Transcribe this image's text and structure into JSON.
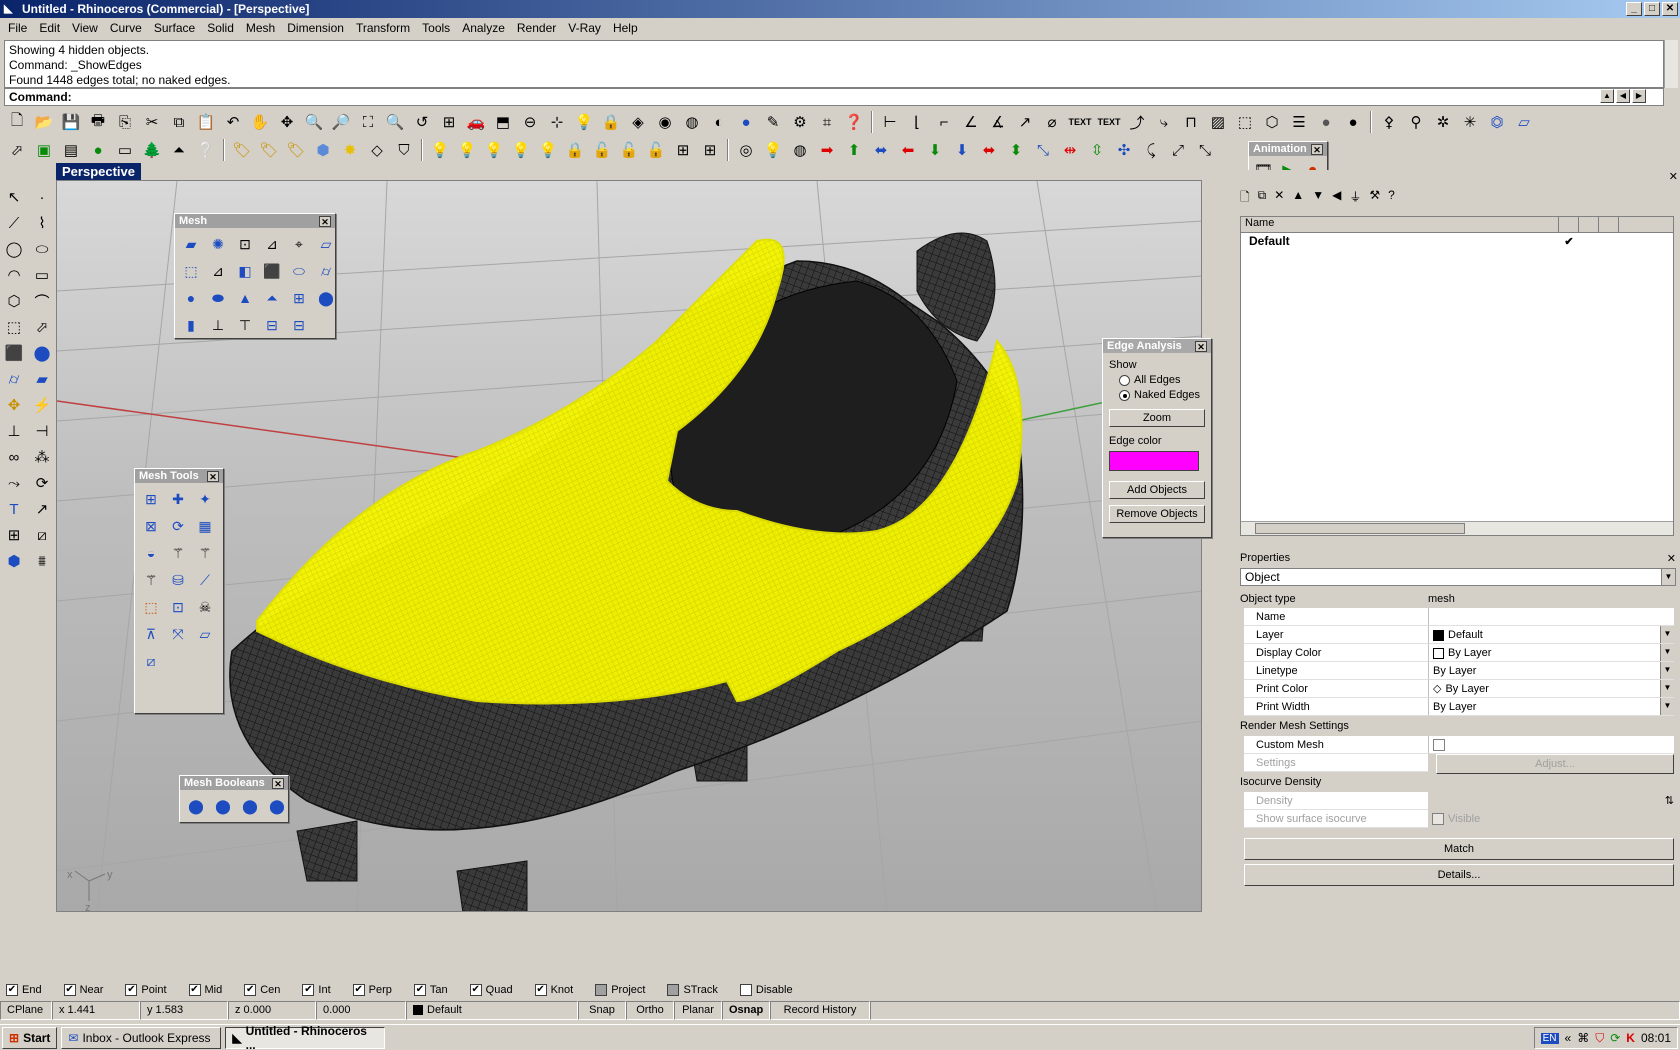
{
  "window": {
    "title": "Untitled - Rhinoceros (Commercial) - [Perspective]",
    "minimize": "_",
    "maximize": "□",
    "close": "✕"
  },
  "menu": [
    "File",
    "Edit",
    "View",
    "Curve",
    "Surface",
    "Solid",
    "Mesh",
    "Dimension",
    "Transform",
    "Tools",
    "Analyze",
    "Render",
    "V-Ray",
    "Help"
  ],
  "command": {
    "history": [
      "Showing 4 hidden objects.",
      "Command: _ShowEdges",
      "Found 1448 edges total; no naked edges."
    ],
    "prompt_label": "Command:",
    "value": ""
  },
  "toolbar_text": {
    "text1": "TEXT",
    "text2": "TEXT"
  },
  "viewport": {
    "title": "Perspective",
    "axis_x": "x",
    "axis_y": "y",
    "axis_z": "z"
  },
  "palettes": {
    "mesh": {
      "title": "Mesh"
    },
    "mesh_tools": {
      "title": "Mesh Tools"
    },
    "mesh_booleans": {
      "title": "Mesh Booleans"
    },
    "animation": {
      "title": "Animation"
    }
  },
  "edge_analysis": {
    "title": "Edge Analysis",
    "show_label": "Show",
    "all_edges": "All Edges",
    "naked_edges": "Naked Edges",
    "selected": "naked_edges",
    "zoom": "Zoom",
    "edge_color_label": "Edge color",
    "edge_color": "#ff00ff",
    "add_objects": "Add Objects",
    "remove_objects": "Remove Objects"
  },
  "layers": {
    "column_name": "Name",
    "rows": [
      {
        "name": "Default",
        "current": "✔"
      }
    ]
  },
  "properties": {
    "title": "Properties",
    "selector": "Object",
    "object_type_label": "Object type",
    "object_type_value": "mesh",
    "rows": [
      {
        "key": "Name",
        "value": ""
      },
      {
        "key": "Layer",
        "value": "Default"
      },
      {
        "key": "Display Color",
        "value": "By Layer"
      },
      {
        "key": "Linetype",
        "value": "By Layer"
      },
      {
        "key": "Print Color",
        "value": "By Layer"
      },
      {
        "key": "Print Width",
        "value": "By Layer"
      }
    ],
    "render_mesh_label": "Render Mesh Settings",
    "custom_mesh": "Custom Mesh",
    "settings": "Settings",
    "adjust": "Adjust...",
    "isocurve_label": "Isocurve Density",
    "density": "Density",
    "show_surface_isocurve": "Show surface isocurve",
    "visible": "Visible",
    "match": "Match",
    "details": "Details..."
  },
  "osnaps": [
    {
      "label": "End",
      "on": true
    },
    {
      "label": "Near",
      "on": true
    },
    {
      "label": "Point",
      "on": true
    },
    {
      "label": "Mid",
      "on": true
    },
    {
      "label": "Cen",
      "on": true
    },
    {
      "label": "Int",
      "on": true
    },
    {
      "label": "Perp",
      "on": true
    },
    {
      "label": "Tan",
      "on": true
    },
    {
      "label": "Quad",
      "on": true
    },
    {
      "label": "Knot",
      "on": true
    },
    {
      "label": "Project",
      "on": false
    },
    {
      "label": "STrack",
      "on": false
    },
    {
      "label": "Disable",
      "on": false
    }
  ],
  "status": {
    "cplane": "CPlane",
    "x": "x 1.441",
    "y": "y 1.583",
    "z": "z 0.000",
    "dist": "0.000",
    "layer": "Default",
    "snap": "Snap",
    "ortho": "Ortho",
    "planar": "Planar",
    "osnap": "Osnap",
    "record_history": "Record History"
  },
  "taskbar": {
    "start": "Start",
    "task1": "Inbox - Outlook Express",
    "task2": "Untitled - Rhinoceros ...",
    "lang": "EN",
    "chevron": "«",
    "time": "08:01"
  },
  "colors": {
    "mesh_highlight": "#f5f500",
    "mesh_dark": "#2a2a2a",
    "title_bar": "#0a246a"
  }
}
